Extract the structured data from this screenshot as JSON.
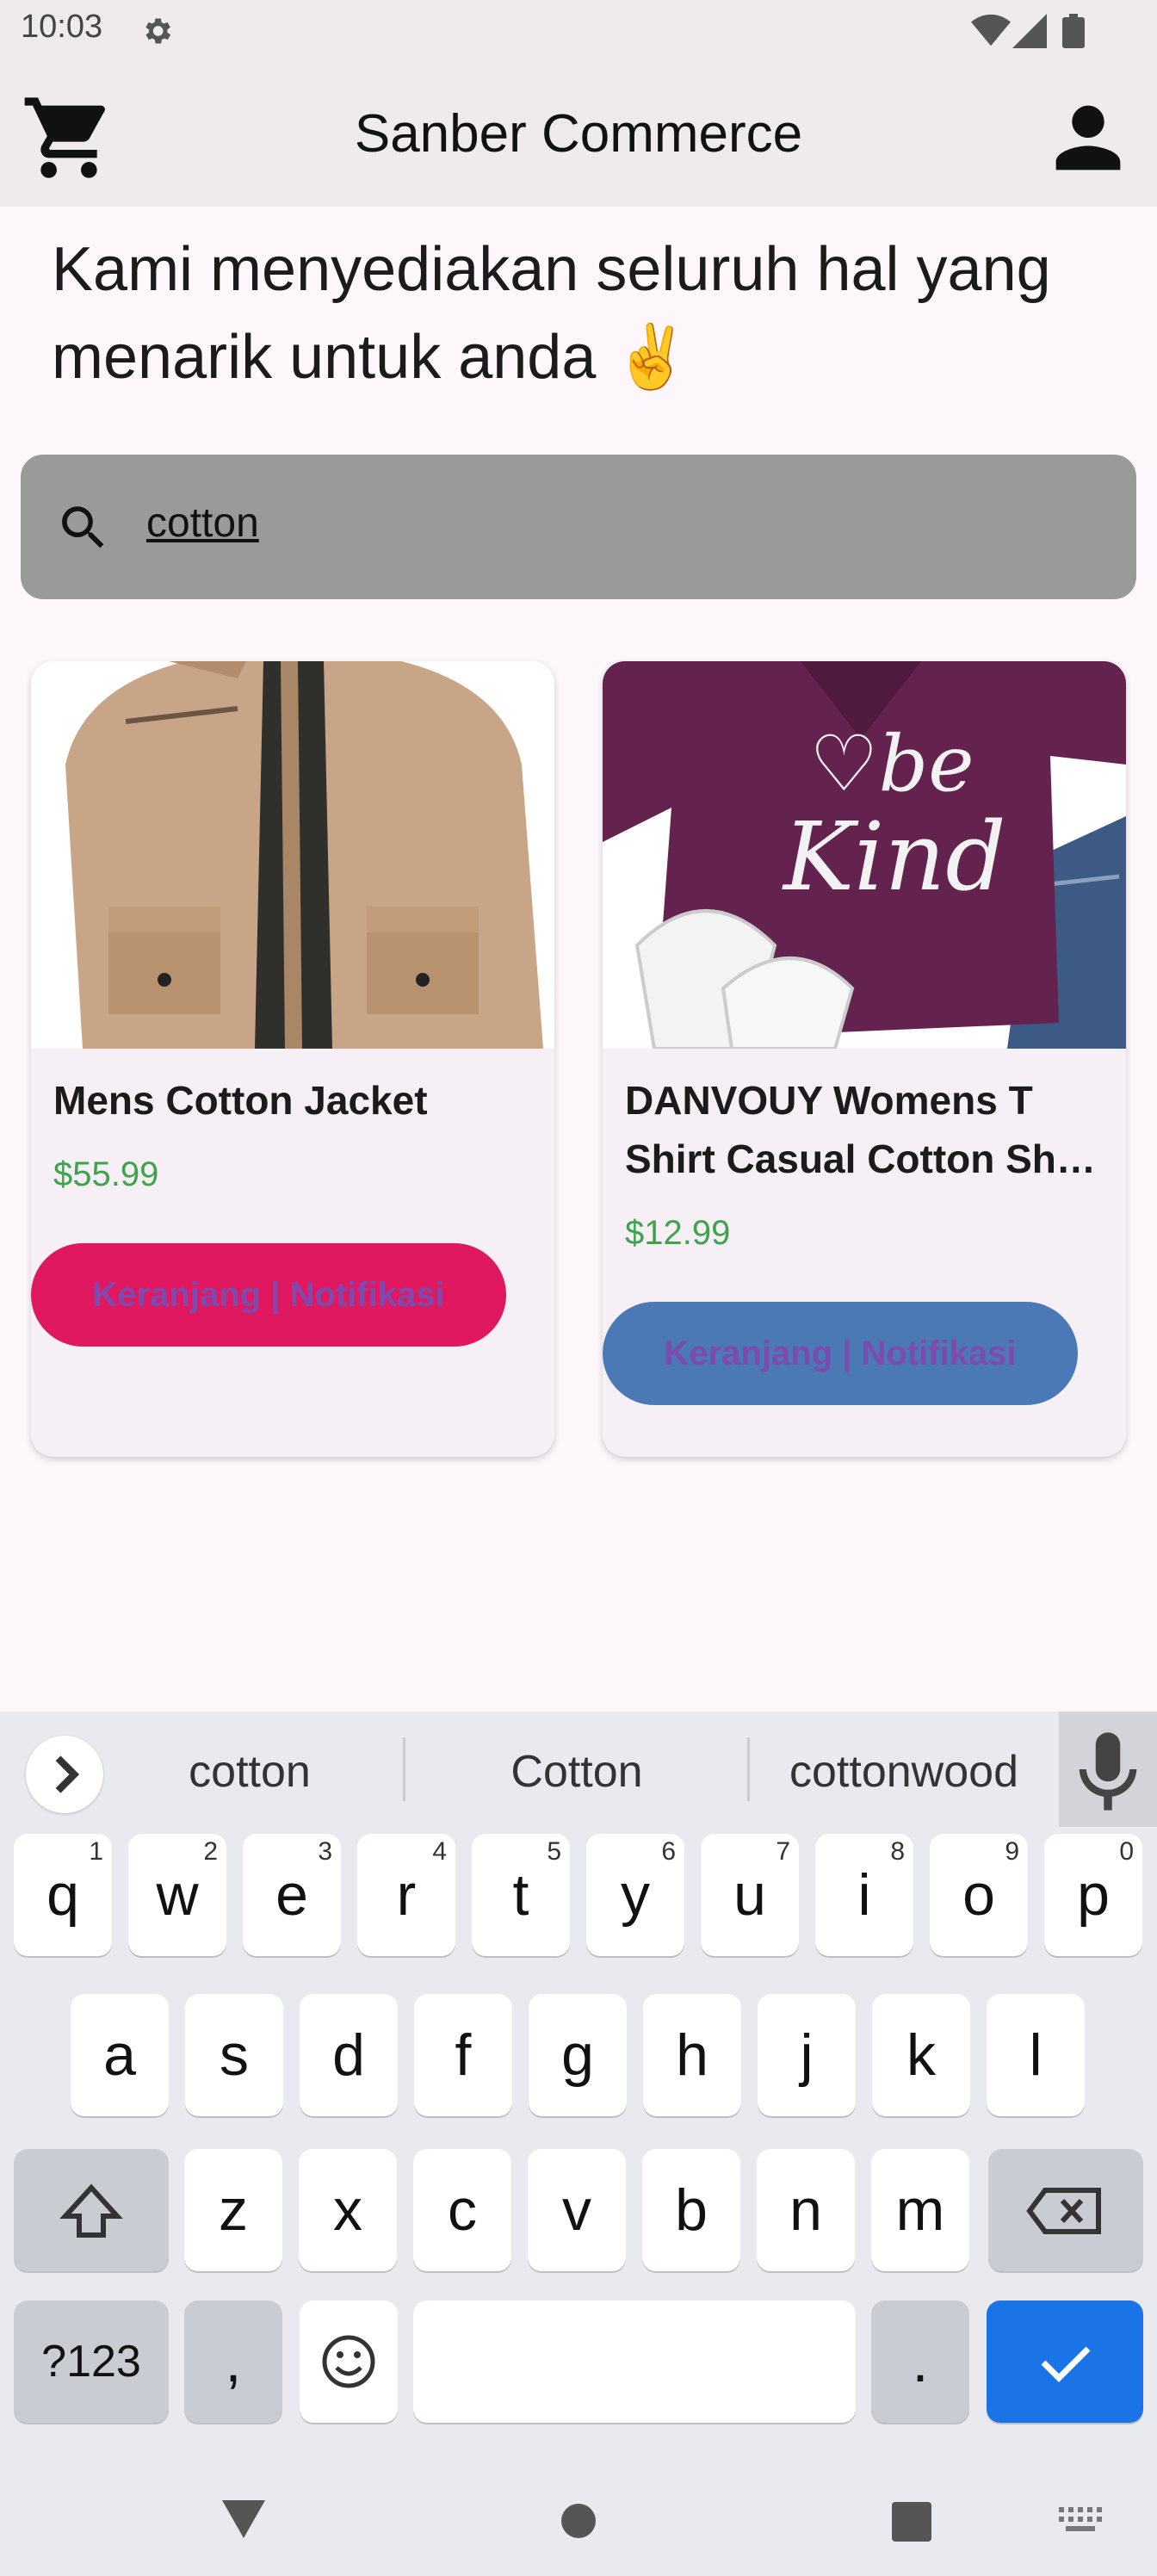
{
  "status_bar": {
    "time": "10:03"
  },
  "app": {
    "title": "Sanber Commerce"
  },
  "headline": "Kami menyediakan seluruh hal yang menarik untuk anda ✌️",
  "search": {
    "value": "cotton"
  },
  "products": [
    {
      "name": "Mens Cotton Jacket",
      "price": "$55.99",
      "button_label": "Keranjang | Notifikasi",
      "button_color": "#e0185f"
    },
    {
      "name": "DANVOUY Womens T Shirt Casual Cotton Sh…",
      "price": "$12.99",
      "button_label": "Keranjang | Notifikasi",
      "button_color": "#4a79b5"
    }
  ],
  "keyboard": {
    "suggestions": [
      "cotton",
      "Cotton",
      "cottonwood"
    ],
    "row1": [
      "q",
      "w",
      "e",
      "r",
      "t",
      "y",
      "u",
      "i",
      "o",
      "p"
    ],
    "row1_numbers": [
      "1",
      "2",
      "3",
      "4",
      "5",
      "6",
      "7",
      "8",
      "9",
      "0"
    ],
    "row2": [
      "a",
      "s",
      "d",
      "f",
      "g",
      "h",
      "j",
      "k",
      "l"
    ],
    "row3": [
      "z",
      "x",
      "c",
      "v",
      "b",
      "n",
      "m"
    ],
    "symbols_key": "?123",
    "comma_key": ",",
    "period_key": ".",
    "enter_color": "#1b73e8"
  }
}
